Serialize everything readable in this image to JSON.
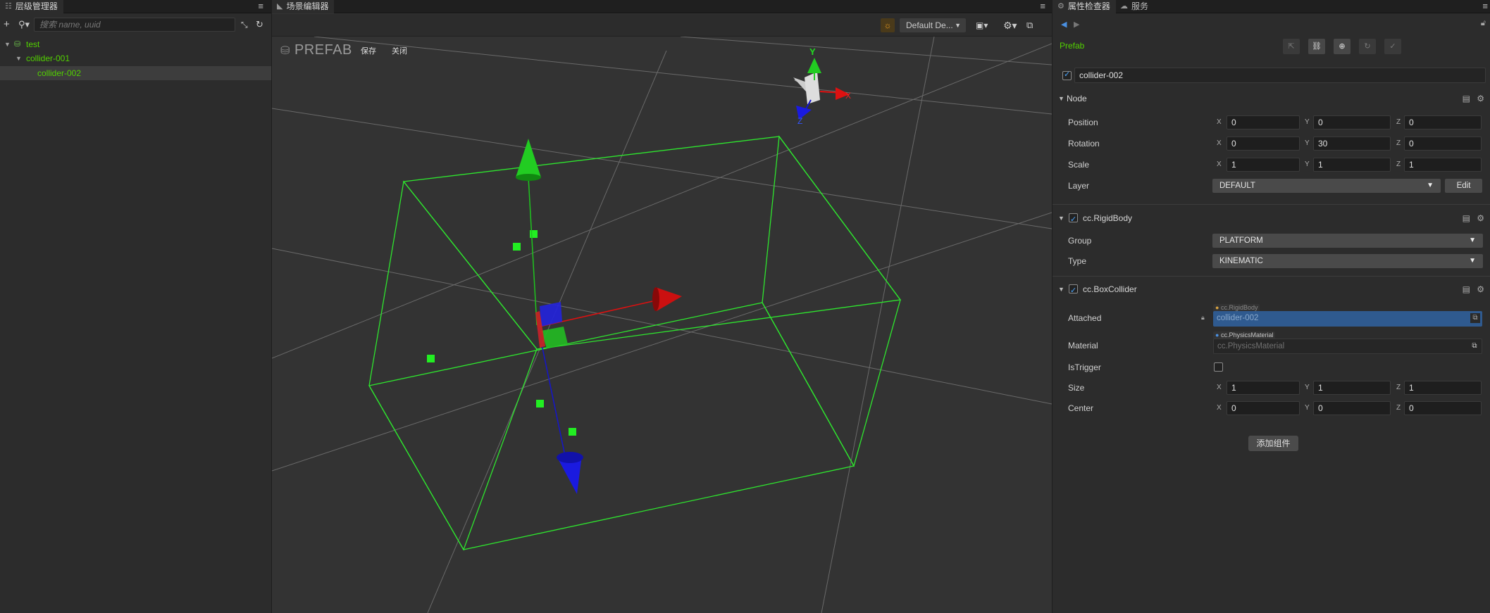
{
  "hierarchy": {
    "tab_title": "层级管理器",
    "search_placeholder": "搜索 name, uuid",
    "tree": [
      {
        "label": "test",
        "depth": 0
      },
      {
        "label": "collider-001",
        "depth": 1
      },
      {
        "label": "collider-002",
        "depth": 2
      }
    ]
  },
  "scene": {
    "tab_title": "场景编辑器",
    "camera_dropdown": "Default De...",
    "prefab_mode_label": "PREFAB",
    "save_label": "保存",
    "close_label": "关闭",
    "gizmo_axes": {
      "x": "X",
      "y": "Y",
      "z": "Z"
    }
  },
  "inspector": {
    "tab_title": "属性检查器",
    "services_tab": "服务",
    "asset_type": "Prefab",
    "node_name": "collider-002",
    "node_section": "Node",
    "position": {
      "label": "Position",
      "x": "0",
      "y": "0",
      "z": "0"
    },
    "rotation": {
      "label": "Rotation",
      "x": "0",
      "y": "30",
      "z": "0"
    },
    "scale": {
      "label": "Scale",
      "x": "1",
      "y": "1",
      "z": "1"
    },
    "layer": {
      "label": "Layer",
      "value": "DEFAULT",
      "edit": "Edit"
    },
    "rigidbody": {
      "title": "cc.RigidBody",
      "group_label": "Group",
      "group_value": "PLATFORM",
      "type_label": "Type",
      "type_value": "KINEMATIC"
    },
    "boxcollider": {
      "title": "cc.BoxCollider",
      "attached_label": "Attached",
      "attached_tag": "cc.RigidBody",
      "attached_value": "collider-002",
      "material_label": "Material",
      "material_tag": "cc.PhysicsMaterial",
      "material_value": "cc.PhysicsMaterial",
      "istrigger_label": "IsTrigger",
      "size": {
        "label": "Size",
        "x": "1",
        "y": "1",
        "z": "1"
      },
      "center": {
        "label": "Center",
        "x": "0",
        "y": "0",
        "z": "0"
      }
    },
    "add_component": "添加组件"
  },
  "axis_labels": {
    "x": "X",
    "y": "Y",
    "z": "Z"
  },
  "colors": {
    "green_text": "#52d100",
    "box_wire": "#2ee62e",
    "axis_red": "#e01010",
    "axis_green": "#1fc41f",
    "axis_blue": "#1010e0",
    "accent_blue": "#3e6ea8"
  }
}
